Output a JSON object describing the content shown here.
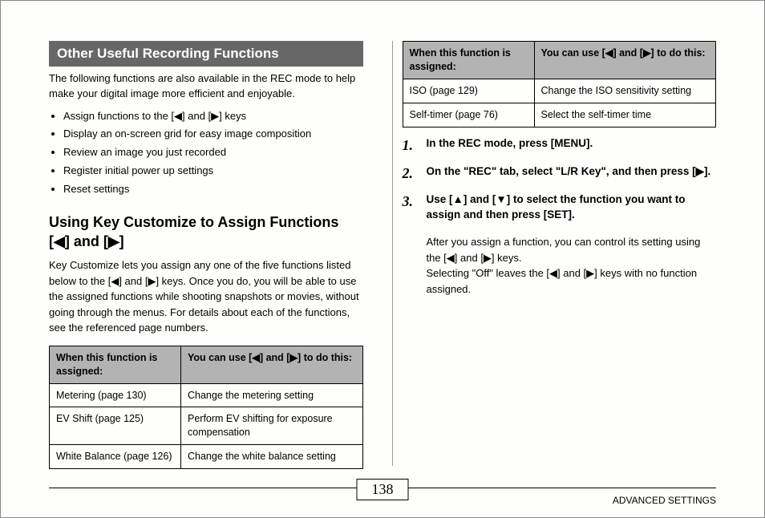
{
  "header": {
    "title": "Other Useful Recording Functions"
  },
  "intro": "The following functions are also available in the REC mode to help make your digital image more efficient and enjoyable.",
  "bullets": [
    "Assign functions to the [◀] and [▶] keys",
    "Display an on-screen grid for easy image composition",
    "Review an image you just recorded",
    "Register initial power up settings",
    "Reset settings"
  ],
  "subhead": "Using Key Customize to Assign Functions [◀] and [▶]",
  "subhead_body": "Key Customize lets you assign any one of the five functions listed below to the [◀] and [▶] keys. Once you do, you will be able to use the assigned functions while shooting snapshots or movies, without going through the menus. For details about each of the functions, see the referenced page numbers.",
  "table_header": {
    "col1": "When this function is assigned:",
    "col2": "You can use [◀] and [▶] to do this:"
  },
  "table_left": [
    {
      "fn": "Metering (page 130)",
      "desc": "Change the metering setting"
    },
    {
      "fn": "EV Shift (page 125)",
      "desc": "Perform EV shifting for exposure compensation"
    },
    {
      "fn": "White Balance (page 126)",
      "desc": "Change the white balance setting"
    }
  ],
  "table_right": [
    {
      "fn": "ISO (page 129)",
      "desc": "Change the ISO sensitivity setting"
    },
    {
      "fn": "Self-timer (page 76)",
      "desc": "Select the self-timer time"
    }
  ],
  "steps": [
    {
      "n": "1.",
      "head": "In the REC mode, press [MENU]."
    },
    {
      "n": "2.",
      "head": "On the \"REC\" tab, select \"L/R Key\", and then press [▶]."
    },
    {
      "n": "3.",
      "head": "Use [▲] and [▼] to select the function you want to assign and then press [SET]."
    }
  ],
  "step_detail": "After you assign a function, you can control its setting using the [◀] and [▶] keys.\nSelecting \"Off\" leaves the [◀] and [▶] keys with no function assigned.",
  "footer": {
    "page": "138",
    "section": "ADVANCED SETTINGS"
  }
}
